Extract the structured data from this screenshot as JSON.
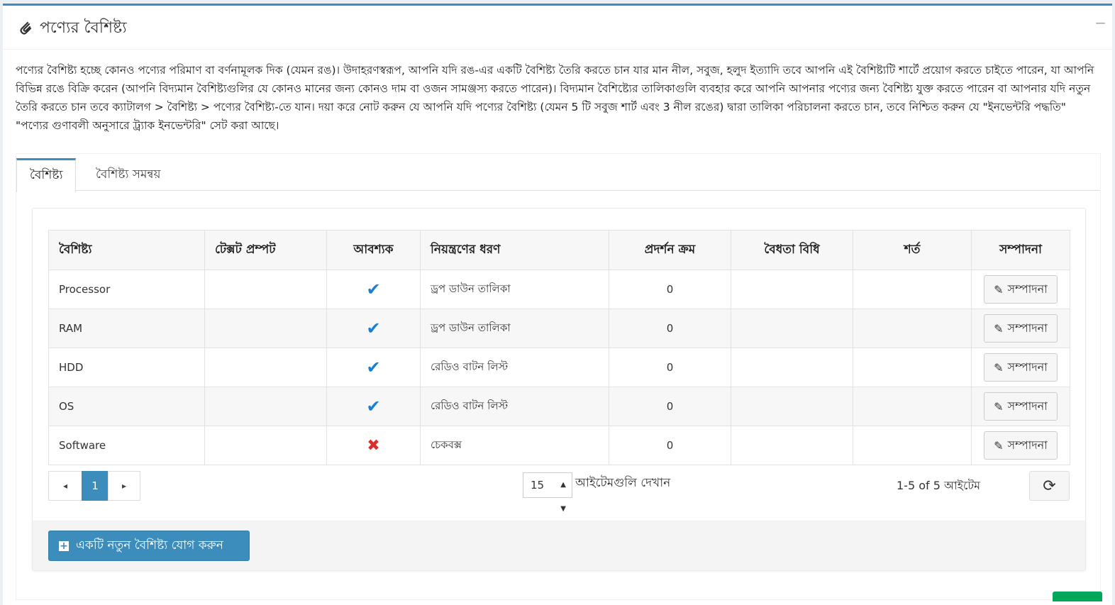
{
  "header": {
    "title": "পণ্যের বৈশিষ্ট্য",
    "icon": "paperclip-icon",
    "collapse_label": "−"
  },
  "description": "পণ্যের বৈশিষ্ট্য হচ্ছে কোনও পণ্যের পরিমাণ বা বর্ণনামূলক দিক (যেমন রঙ)। উদাহরণস্বরূপ, আপনি যদি রঙ-এর একটি বৈশিষ্ট্য তৈরি করতে চান যার মান নীল, সবুজ, হলুদ ইত্যাদি তবে আপনি এই বৈশিষ্ট্যটি শার্টে প্রয়োগ করতে চাইতে পারেন, যা আপনি বিভিন্ন রঙে বিক্রি করেন (আপনি বিদ্যমান বৈশিষ্ট্যগুলির যে কোনও মানের জন্য কোনও দাম বা ওজন সামঞ্জস্য করতে পারেন)। বিদ্যমান বৈশিষ্ট্যের তালিকাগুলি ব্যবহার করে আপনি আপনার পণ্যের জন্য বৈশিষ্ট্য যুক্ত করতে পারেন বা আপনার যদি নতুন তৈরি করতে চান তবে ক্যাটালগ > বৈশিষ্ট্য > পণ্যের বৈশিষ্ট্য-তে যান। দয়া করে নোট করুন যে আপনি যদি পণ্যের বৈশিষ্ট্য (যেমন 5 টি সবুজ শার্ট এবং 3 নীল রঙের) দ্বারা তালিকা পরিচালনা করতে চান, তবে নিশ্চিত করুন যে \"ইনভেন্টরি পদ্ধতি\" \"পণ্যের গুণাবলী অনুসারে ট্র্যাক ইনভেন্টরি\" সেট করা আছে।",
  "tabs": [
    {
      "label": "বৈশিষ্ট্য",
      "active": true
    },
    {
      "label": "বৈশিষ্ট্য সমন্বয়",
      "active": false
    }
  ],
  "table": {
    "columns": [
      "বৈশিষ্ট্য",
      "টেক্সট প্রম্পট",
      "আবশ্যক",
      "নিয়ন্ত্রণের ধরণ",
      "প্রদর্শন ক্রম",
      "বৈধতা বিধি",
      "শর্ত",
      "সম্পাদনা"
    ],
    "rows": [
      {
        "attribute": "Processor",
        "prompt": "",
        "required": true,
        "control": "ড্রপ ডাউন তালিকা",
        "order": "0",
        "validation": "",
        "condition": "",
        "edit": "সম্পাদনা"
      },
      {
        "attribute": "RAM",
        "prompt": "",
        "required": true,
        "control": "ড্রপ ডাউন তালিকা",
        "order": "0",
        "validation": "",
        "condition": "",
        "edit": "সম্পাদনা"
      },
      {
        "attribute": "HDD",
        "prompt": "",
        "required": true,
        "control": "রেডিও বাটন লিস্ট",
        "order": "0",
        "validation": "",
        "condition": "",
        "edit": "সম্পাদনা"
      },
      {
        "attribute": "OS",
        "prompt": "",
        "required": true,
        "control": "রেডিও বাটন লিস্ট",
        "order": "0",
        "validation": "",
        "condition": "",
        "edit": "সম্পাদনা"
      },
      {
        "attribute": "Software",
        "prompt": "",
        "required": false,
        "control": "চেকবক্স",
        "order": "0",
        "validation": "",
        "condition": "",
        "edit": "সম্পাদনা"
      }
    ]
  },
  "pager": {
    "prev": "◂",
    "current_page": "1",
    "next": "▸",
    "page_size": "15",
    "page_size_label": "আইটেমগুলি দেখান",
    "items_info": "1-5 of 5 আইটেম"
  },
  "footer": {
    "add_label": "একটি নতুন বৈশিষ্ট্য যোগ করুন"
  },
  "colors": {
    "accent": "#3c8dbc",
    "check": "#1a7fd4",
    "cross": "#d9302c",
    "success": "#00a65a"
  }
}
